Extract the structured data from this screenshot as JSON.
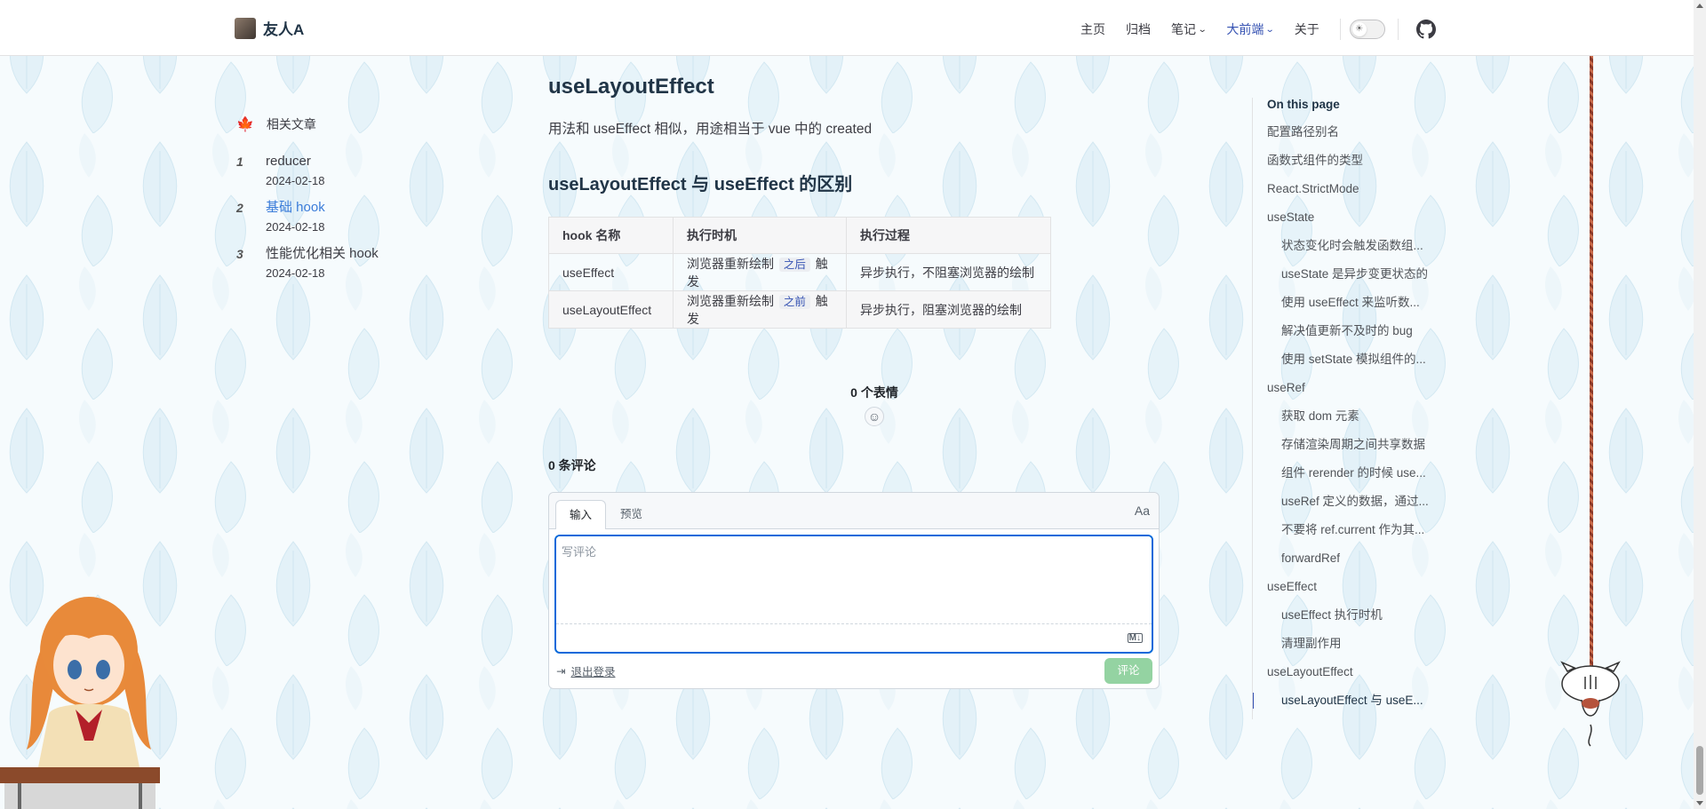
{
  "site": {
    "name": "友人A"
  },
  "nav": {
    "items": [
      {
        "label": "主页",
        "dropdown": false,
        "active": false
      },
      {
        "label": "归档",
        "dropdown": false,
        "active": false
      },
      {
        "label": "笔记",
        "dropdown": true,
        "active": false
      },
      {
        "label": "大前端",
        "dropdown": true,
        "active": true
      },
      {
        "label": "关于",
        "dropdown": false,
        "active": false
      }
    ],
    "theme_icon": "sun-icon",
    "social_icon": "github-icon"
  },
  "related": {
    "heading": "相关文章",
    "items": [
      {
        "num": "1",
        "title": "reducer",
        "date": "2024-02-18"
      },
      {
        "num": "2",
        "title": "基础 hook",
        "date": "2024-02-18"
      },
      {
        "num": "3",
        "title": "性能优化相关 hook",
        "date": "2024-02-18"
      }
    ]
  },
  "article": {
    "h2": "useLayoutEffect",
    "para": "用法和 useEffect 相似，用途相当于 vue 中的 created",
    "h3": "useLayoutEffect 与 useEffect 的区别",
    "table": {
      "headers": [
        "hook 名称",
        "执行时机",
        "执行过程"
      ],
      "rows": [
        {
          "name": "useEffect",
          "timing_pre": "浏览器重新绘制",
          "timing_tag": "之后",
          "timing_post": "触发",
          "process": "异步执行，不阻塞浏览器的绘制"
        },
        {
          "name": "useLayoutEffect",
          "timing_pre": "浏览器重新绘制",
          "timing_tag": "之前",
          "timing_post": "触发",
          "process": "异步执行，阻塞浏览器的绘制"
        }
      ]
    }
  },
  "comments": {
    "reactions_label": "0 个表情",
    "count_label": "0 条评论",
    "tab_write": "输入",
    "tab_preview": "预览",
    "font_toggle": "Aa",
    "placeholder": "写评论",
    "markdown_badge": "M↓",
    "logout": "退出登录",
    "submit": "评论",
    "accent": "#0969da",
    "submit_color": "#94d3a2"
  },
  "toc": {
    "title": "On this page",
    "items": [
      {
        "label": "配置路径别名",
        "level": 1
      },
      {
        "label": "函数式组件的类型",
        "level": 1
      },
      {
        "label": "React.StrictMode",
        "level": 1
      },
      {
        "label": "useState",
        "level": 1
      },
      {
        "label": "状态变化时会触发函数组...",
        "level": 2
      },
      {
        "label": "useState 是异步变更状态的",
        "level": 2
      },
      {
        "label": "使用 useEffect 来监听数...",
        "level": 2
      },
      {
        "label": "解决值更新不及时的 bug",
        "level": 2
      },
      {
        "label": "使用 setState 模拟组件的...",
        "level": 2
      },
      {
        "label": "useRef",
        "level": 1
      },
      {
        "label": "获取 dom 元素",
        "level": 2
      },
      {
        "label": "存储渲染周期之间共享数据",
        "level": 2
      },
      {
        "label": "组件 rerender 的时候 use...",
        "level": 2
      },
      {
        "label": "useRef 定义的数据，通过...",
        "level": 2
      },
      {
        "label": "不要将 ref.current 作为其...",
        "level": 2
      },
      {
        "label": "forwardRef",
        "level": 2
      },
      {
        "label": "useEffect",
        "level": 1
      },
      {
        "label": "useEffect 执行时机",
        "level": 2
      },
      {
        "label": "清理副作用",
        "level": 2
      },
      {
        "label": "useLayoutEffect",
        "level": 1
      },
      {
        "label": "useLayoutEffect 与 useE...",
        "level": 2,
        "current": true
      }
    ]
  }
}
